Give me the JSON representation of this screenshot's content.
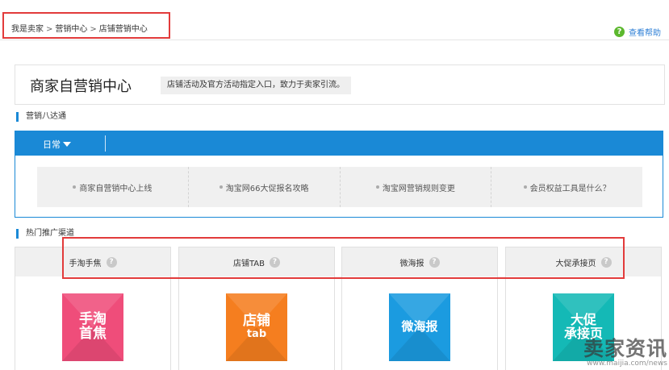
{
  "breadcrumb": {
    "items": [
      "我是卖家",
      "营销中心",
      "店铺营销中心"
    ],
    "separator": ">"
  },
  "help": {
    "label": "查看帮助",
    "icon": "question-circle-icon"
  },
  "header": {
    "title": "商家自营销中心",
    "description": "店铺活动及官方活动指定入口，致力于卖家引流。"
  },
  "section1": {
    "title": "营销八达通",
    "dropdown_label": "日常",
    "links": [
      "商家自营销中心上线",
      "淘宝网66大促报名攻略",
      "淘宝网营销规则变更",
      "会员权益工具是什么？"
    ]
  },
  "section2": {
    "title": "热门推广渠道",
    "channels": [
      {
        "name": "手淘手焦",
        "tile_lines": [
          "手淘",
          "首焦"
        ],
        "color": "#ef4d7a"
      },
      {
        "name": "店铺TAB",
        "tile_lines": [
          "店铺",
          "tab"
        ],
        "color": "#f57e1f"
      },
      {
        "name": "微海报",
        "tile_lines": [
          "微海报"
        ],
        "color": "#1b9be0"
      },
      {
        "name": "大促承接页",
        "tile_lines": [
          "大促",
          "承接页"
        ],
        "color": "#14b9b6"
      }
    ]
  },
  "watermark": {
    "text": "卖家资讯",
    "url": "www.maijia.com/news"
  },
  "colors": {
    "accent": "#1a89d6",
    "highlight": "#e23b3b"
  }
}
